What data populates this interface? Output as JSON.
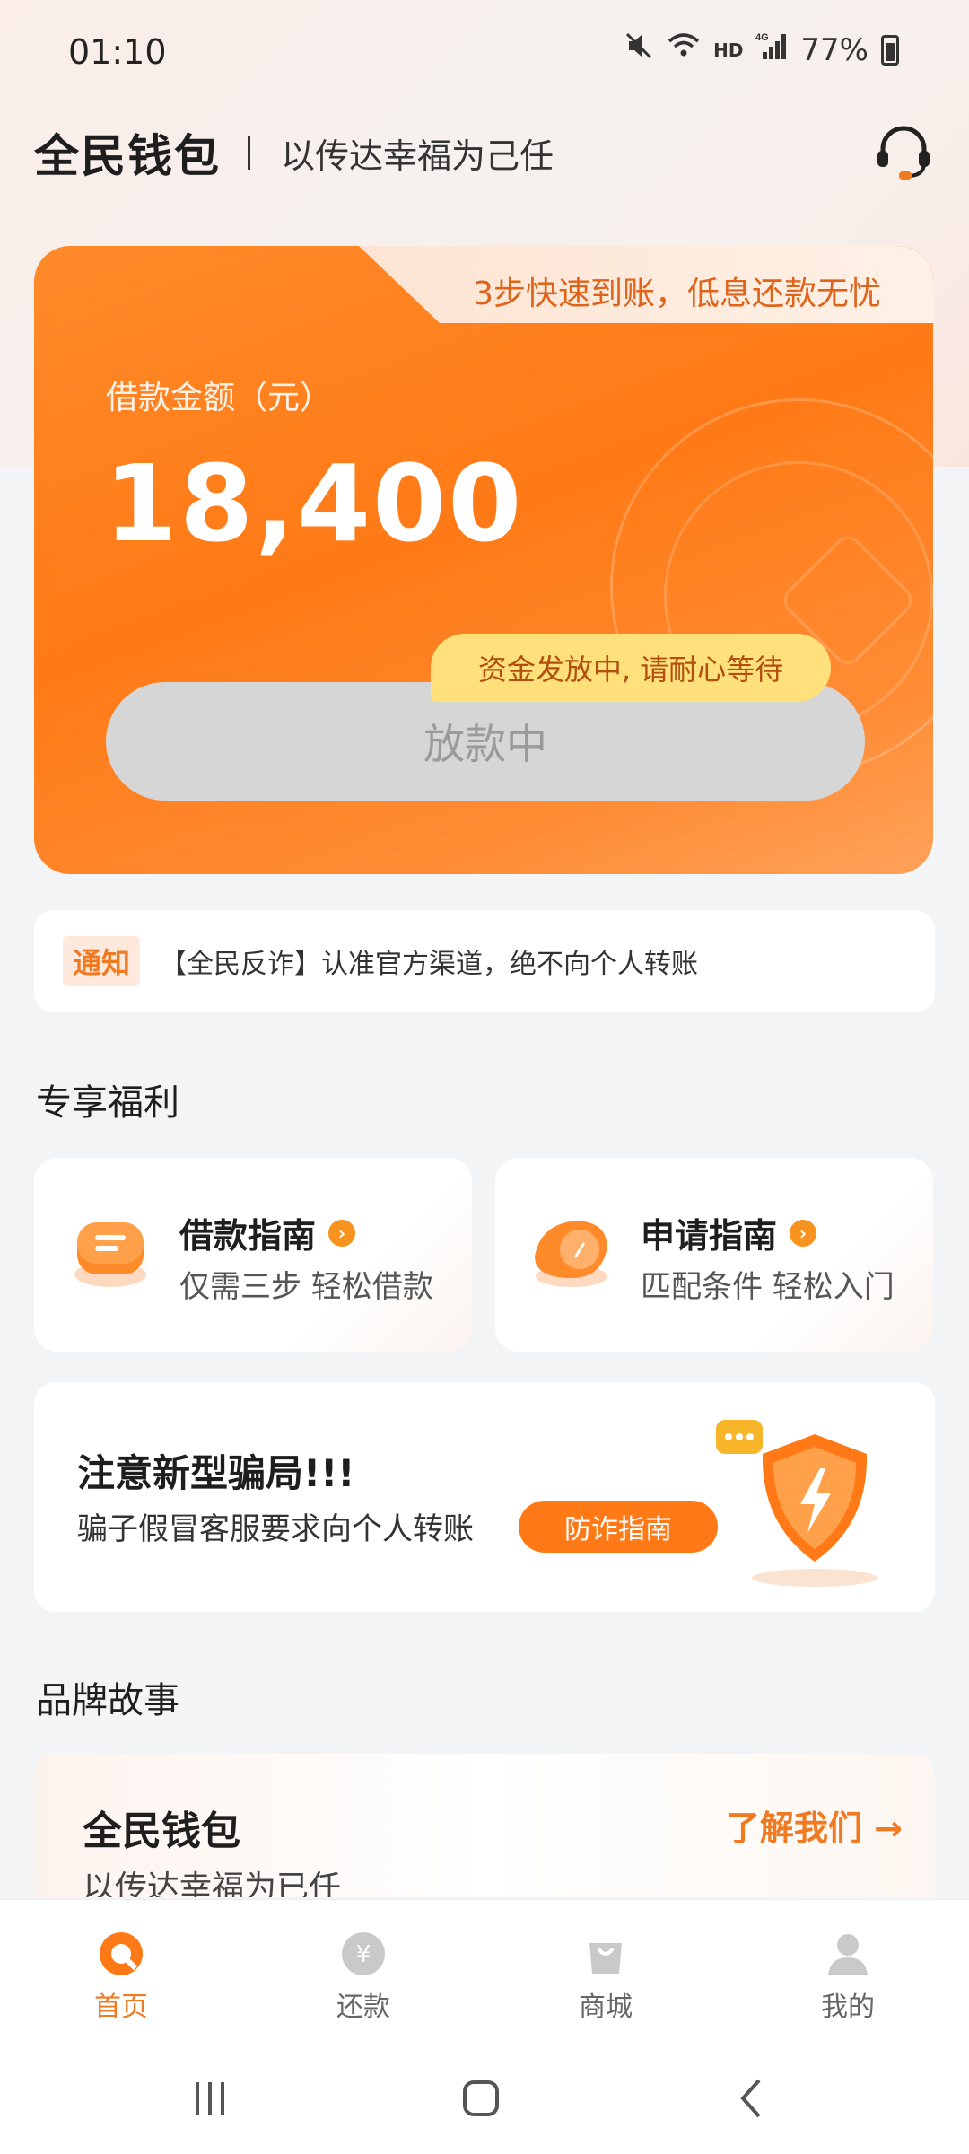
{
  "status_bar": {
    "time": "01:10",
    "network": "HD",
    "signal": "4G",
    "battery": "77%"
  },
  "header": {
    "brand": "全民钱包",
    "slogan": "以传达幸福为己任"
  },
  "loan_card": {
    "tab_text": "3步快速到账，低息还款无忧",
    "amount_label": "借款金额（元）",
    "amount_value": "18,400",
    "tip": "资金发放中, 请耐心等待",
    "button_label": "放款中"
  },
  "notice": {
    "tag": "通知",
    "text": "【全民反诈】认准官方渠道，绝不向个人转账"
  },
  "benefits": {
    "section_title": "专享福利",
    "items": [
      {
        "title": "借款指南",
        "subtitle": "仅需三步 轻松借款",
        "icon": "loan-guide-icon"
      },
      {
        "title": "申请指南",
        "subtitle": "匹配条件 轻松入门",
        "icon": "apply-guide-icon"
      }
    ]
  },
  "fraud_banner": {
    "title": "注意新型骗局!!!",
    "subtitle": "骗子假冒客服要求向个人转账",
    "button": "防诈指南"
  },
  "brand_story": {
    "section_title": "品牌故事",
    "title": "全民钱包",
    "subtitle": "以传达幸福为已任",
    "link": "了解我们 →"
  },
  "bottom_nav": [
    {
      "label": "首页",
      "icon": "home-icon",
      "active": true
    },
    {
      "label": "还款",
      "icon": "repay-icon",
      "active": false
    },
    {
      "label": "商城",
      "icon": "shop-icon",
      "active": false
    },
    {
      "label": "我的",
      "icon": "profile-icon",
      "active": false
    }
  ],
  "colors": {
    "accent": "#ff7a16",
    "accent_text": "#f07a22",
    "tip_bg": "#ffe07a"
  }
}
